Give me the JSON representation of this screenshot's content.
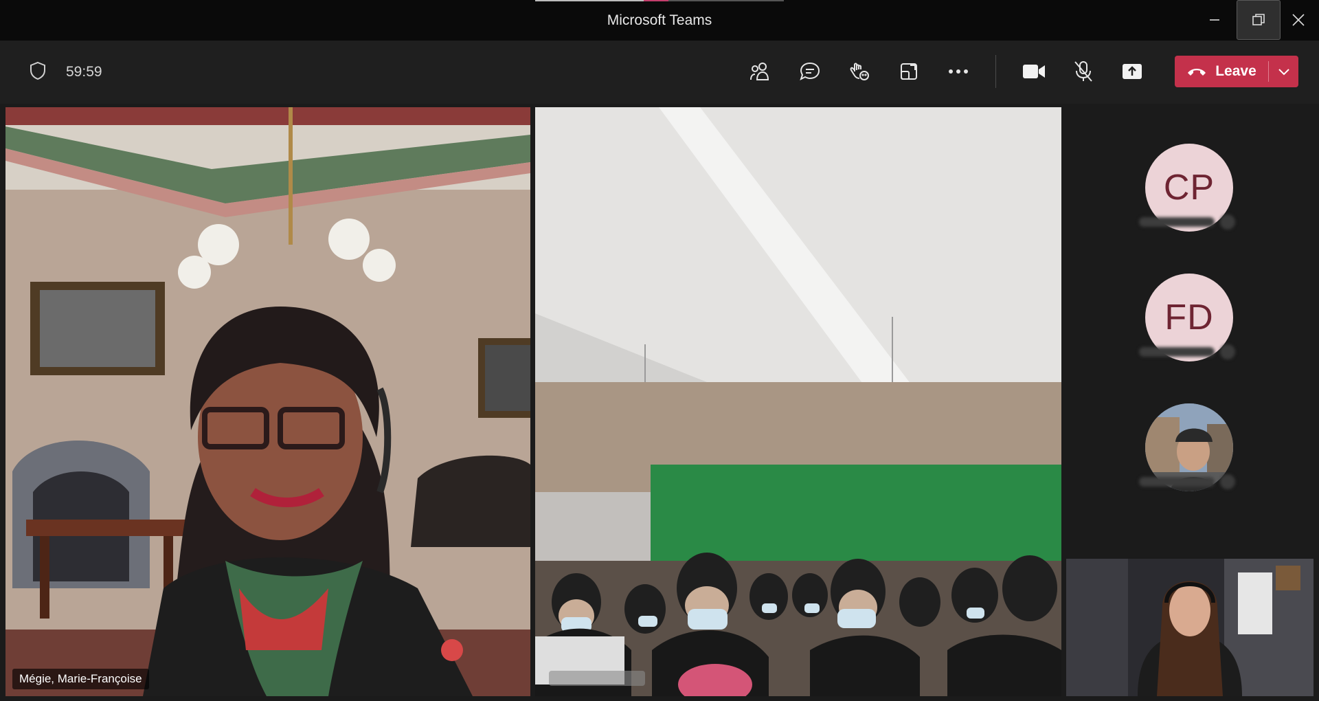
{
  "window": {
    "title": "Microsoft Teams",
    "controls": [
      "minimize-icon",
      "restore-icon",
      "close-icon"
    ],
    "call_progress": 0.44
  },
  "meeting": {
    "timer": "59:59",
    "toolbar_icons": [
      "participants-icon",
      "chat-icon",
      "reactions-icon",
      "rooms-icon",
      "more-icon",
      "camera-icon",
      "mic-off-icon",
      "share-icon"
    ],
    "leave_label": "Leave",
    "leave_color": "#c4314b"
  },
  "participants": {
    "main_left_name": "Mégie, Marie-Françoise",
    "roster": [
      {
        "initials": "CP"
      },
      {
        "initials": "FD"
      },
      {
        "initials": ""
      }
    ]
  },
  "colors": {
    "background": "#1f1f1f",
    "avatar_bg": "#ecd3d7",
    "avatar_text": "#6e2432"
  }
}
